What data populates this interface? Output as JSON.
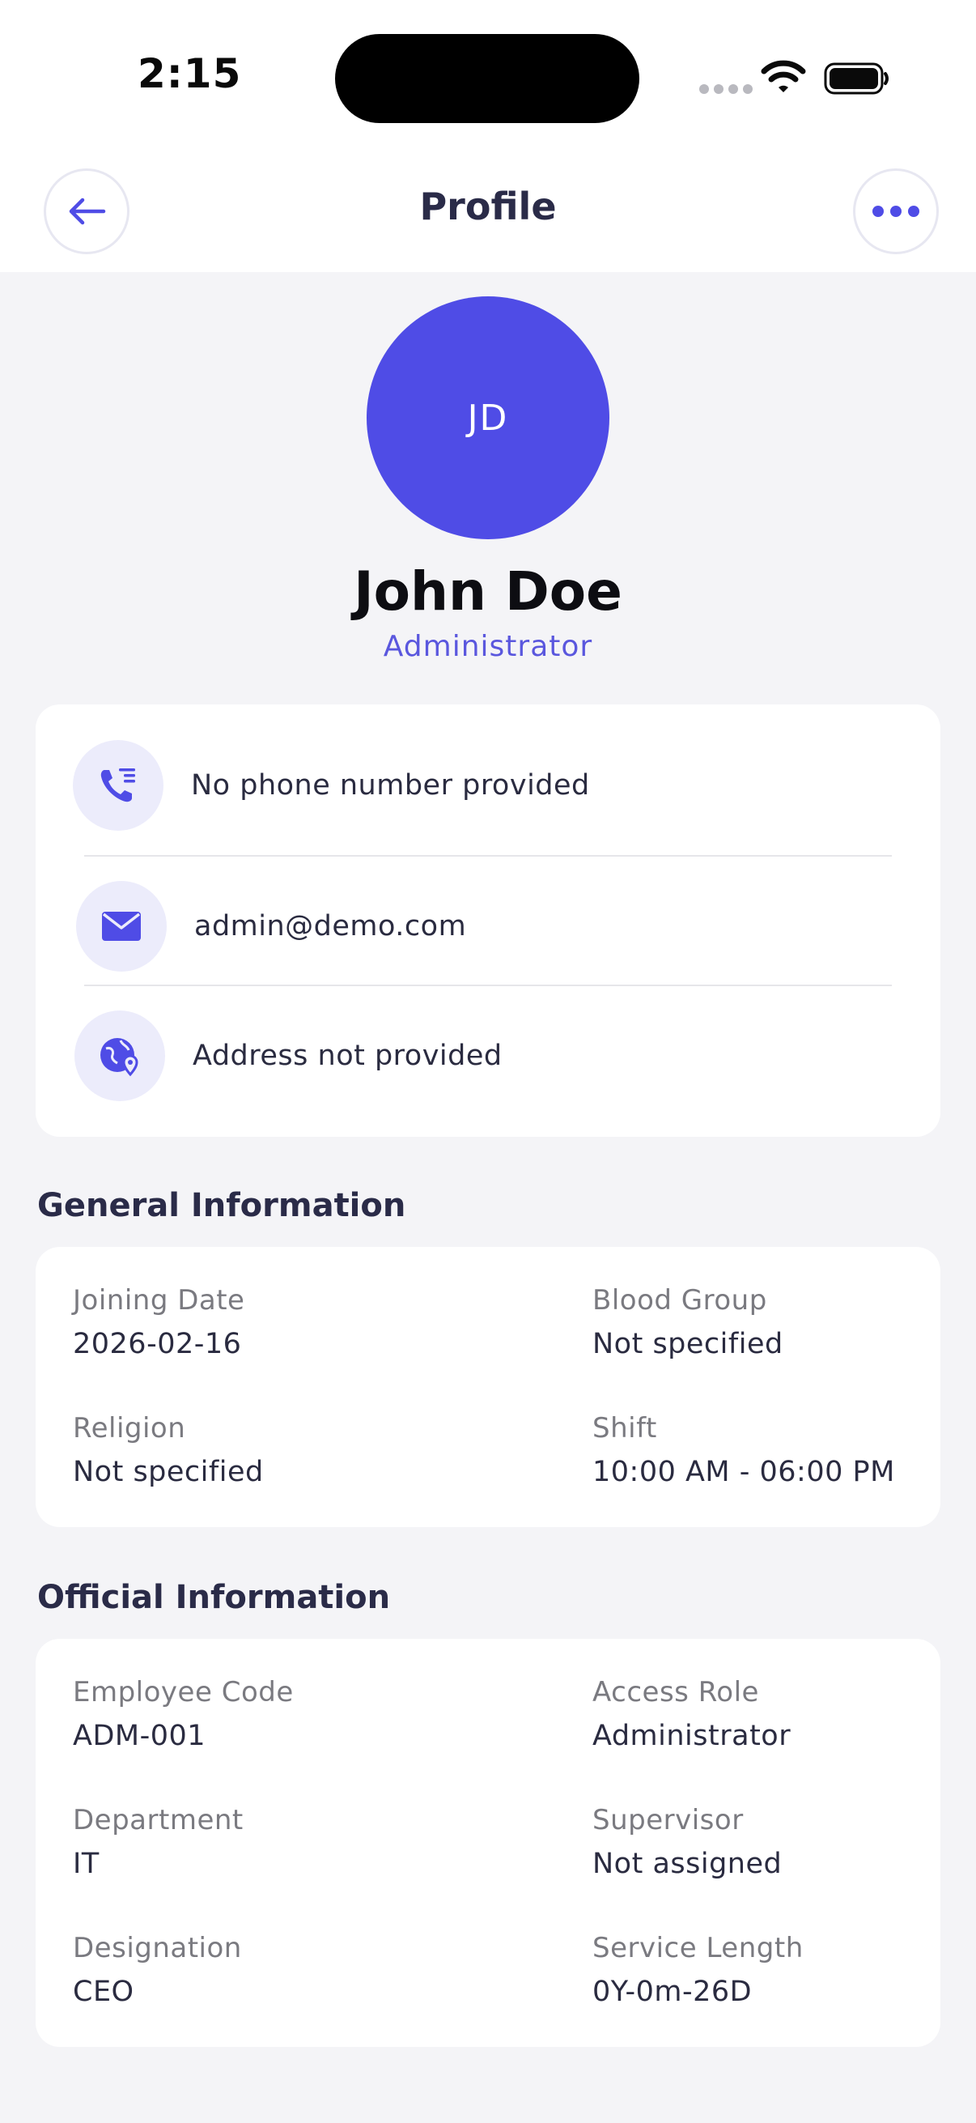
{
  "status_bar": {
    "time": "2:15"
  },
  "header": {
    "title": "Profile",
    "back_icon": "arrow-left-icon",
    "more_icon": "more-horizontal-icon"
  },
  "profile": {
    "initials": "JD",
    "name": "John Doe",
    "role": "Administrator"
  },
  "contact": [
    {
      "icon": "phone-list-icon",
      "text": "No phone number provided"
    },
    {
      "icon": "mail-icon",
      "text": "admin@demo.com"
    },
    {
      "icon": "globe-location-icon",
      "text": "Address not provided"
    }
  ],
  "general_information": {
    "title": "General Information",
    "fields": [
      {
        "label": "Joining Date",
        "value": "2026-02-16"
      },
      {
        "label": "Blood Group",
        "value": "Not specified"
      },
      {
        "label": "Religion",
        "value": "Not specified"
      },
      {
        "label": "Shift",
        "value": "10:00 AM - 06:00 PM"
      }
    ]
  },
  "official_information": {
    "title": "Official Information",
    "fields": [
      {
        "label": "Employee Code",
        "value": "ADM-001"
      },
      {
        "label": "Access Role",
        "value": "Administrator"
      },
      {
        "label": "Department",
        "value": "IT"
      },
      {
        "label": "Supervisor",
        "value": "Not assigned"
      },
      {
        "label": "Designation",
        "value": "CEO"
      },
      {
        "label": "Service Length",
        "value": "0Y-0m-26D"
      }
    ]
  },
  "colors": {
    "accent": "#4f4ce6",
    "accent_light": "#ececfb",
    "background": "#f4f4f7"
  }
}
